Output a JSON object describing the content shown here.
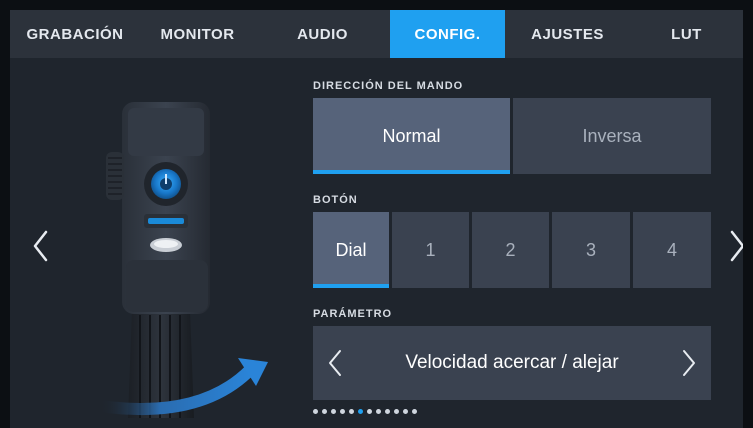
{
  "tabs": [
    {
      "label": "GRABACIÓN",
      "active": false
    },
    {
      "label": "MONITOR",
      "active": false
    },
    {
      "label": "AUDIO",
      "active": false
    },
    {
      "label": "CONFIG.",
      "active": true
    },
    {
      "label": "AJUSTES",
      "active": false
    },
    {
      "label": "LUT",
      "active": false
    }
  ],
  "direction": {
    "label": "DIRECCIÓN DEL MANDO",
    "options": [
      "Normal",
      "Inversa"
    ],
    "selected": "Normal"
  },
  "button": {
    "label": "BOTÓN",
    "options": [
      "Dial",
      "1",
      "2",
      "3",
      "4"
    ],
    "selected": "Dial"
  },
  "parameter": {
    "label": "PARÁMETRO",
    "value": "Velocidad acercar / alejar"
  },
  "pagination": {
    "total": 12,
    "current": 5
  },
  "colors": {
    "accent": "#1fa0f0",
    "panel": "#3a4250",
    "selected": "#56637a"
  }
}
